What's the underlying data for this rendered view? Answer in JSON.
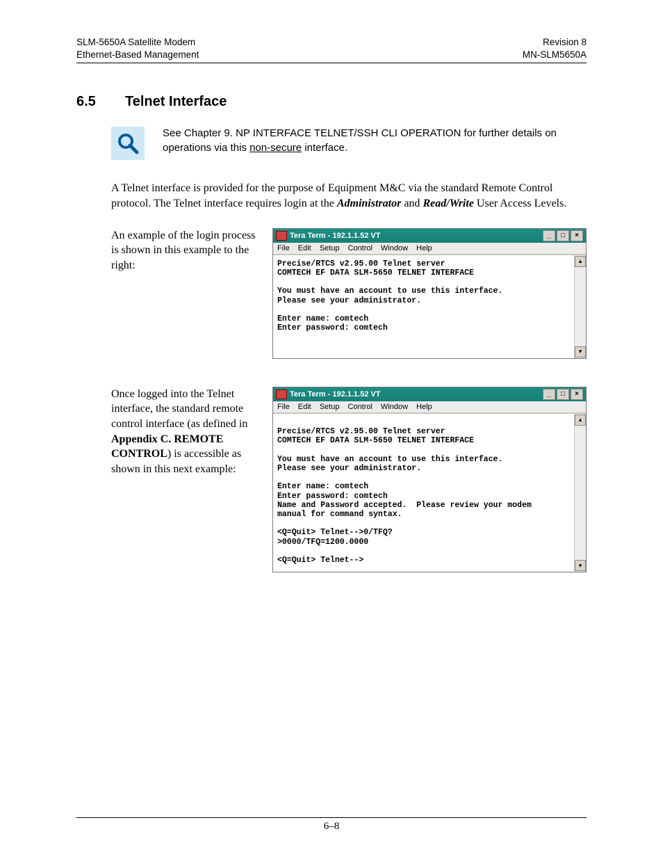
{
  "header": {
    "left1": "SLM-5650A Satellite Modem",
    "left2": "Ethernet-Based Management",
    "right1": "Revision 8",
    "right2": "MN-SLM5650A"
  },
  "section": {
    "number": "6.5",
    "title": "Telnet Interface"
  },
  "note": {
    "pre": "See Chapter 9. NP INTERFACE TELNET/SSH CLI OPERATION for further details on operations via this ",
    "underlined": "non-secure",
    "post": " interface."
  },
  "para1": {
    "a": "A Telnet interface is provided for the purpose of Equipment M&C via the standard Remote Control protocol. The Telnet interface requires login at the ",
    "b": "Administrator",
    "c": " and ",
    "d": "Read/Write",
    "e": " User Access Levels."
  },
  "example1": {
    "left": "An example of the login process is shown in this example to the right:"
  },
  "example2": {
    "a": "Once logged into the Telnet interface, the standard remote control interface (as defined in ",
    "b": "Appendix C. REMOTE CONTROL",
    "c": ") is accessible as shown in this next example:"
  },
  "term": {
    "title": "Tera Term - 192.1.1.52 VT",
    "menu": {
      "file": "File",
      "edit": "Edit",
      "setup": "Setup",
      "control": "Control",
      "window": "Window",
      "help": "Help"
    },
    "btn_min": "_",
    "btn_max": "□",
    "btn_close": "×",
    "scroll_up": "▴",
    "scroll_down": "▾"
  },
  "term1_body": "Precise/RTCS v2.95.00 Telnet server\nCOMTECH EF DATA SLM-5650 TELNET INTERFACE\n\nYou must have an account to use this interface.\nPlease see your administrator.\n\nEnter name: comtech\nEnter password: comtech\n\n\n",
  "term2_body": "\nPrecise/RTCS v2.95.00 Telnet server\nCOMTECH EF DATA SLM-5650 TELNET INTERFACE\n\nYou must have an account to use this interface.\nPlease see your administrator.\n\nEnter name: comtech\nEnter password: comtech\nName and Password accepted.  Please review your modem\nmanual for command syntax.\n\n<Q=Quit> Telnet-->0/TFQ?\n>0000/TFQ=1200.0000\n\n<Q=Quit> Telnet-->",
  "footer": "6–8"
}
